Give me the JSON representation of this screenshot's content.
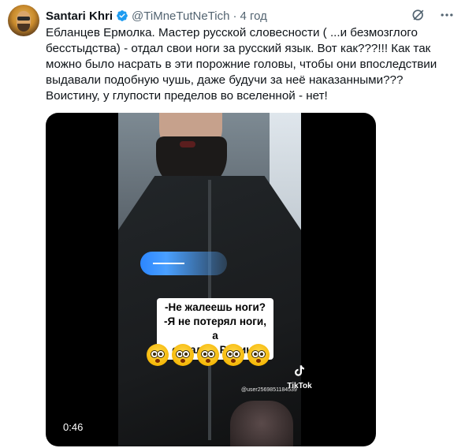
{
  "tweet": {
    "author_name": "Santari Khri",
    "handle": "@TiMneTutNeTich",
    "separator": "·",
    "time": "4 год",
    "text": "Ебланцев Ермолка. Мастер русской словесности ( ...и безмозглого бесстыдства) - отдал свои ноги за русский язык. Вот как???!!! Как так можно было насрать в эти порожние головы, чтобы они впоследствии выдавали подобную чушь, даже будучи за неё наказанными??? Воистину, у глупости пределов во вселенной - нет!"
  },
  "media": {
    "caption": "-Не жалеешь ноги?\n-Я не потерял ноги, а отдал за Родину",
    "caption_line1": "-Не жалеешь ноги?",
    "caption_line2": "-Я не потерял ноги, а",
    "caption_line3": "отдал за Родину",
    "tiktok_label": "TikTok",
    "watermark_user": "@user2569851184539",
    "duration": "0:46"
  },
  "icons": {
    "verified": "verified-badge-icon",
    "grok": "grok-icon",
    "more": "more-options-icon",
    "emoji": "flushed-face-emoji"
  },
  "colors": {
    "verified": "#1d9bf0",
    "secondary_text": "#536471",
    "primary_text": "#0f1419"
  }
}
